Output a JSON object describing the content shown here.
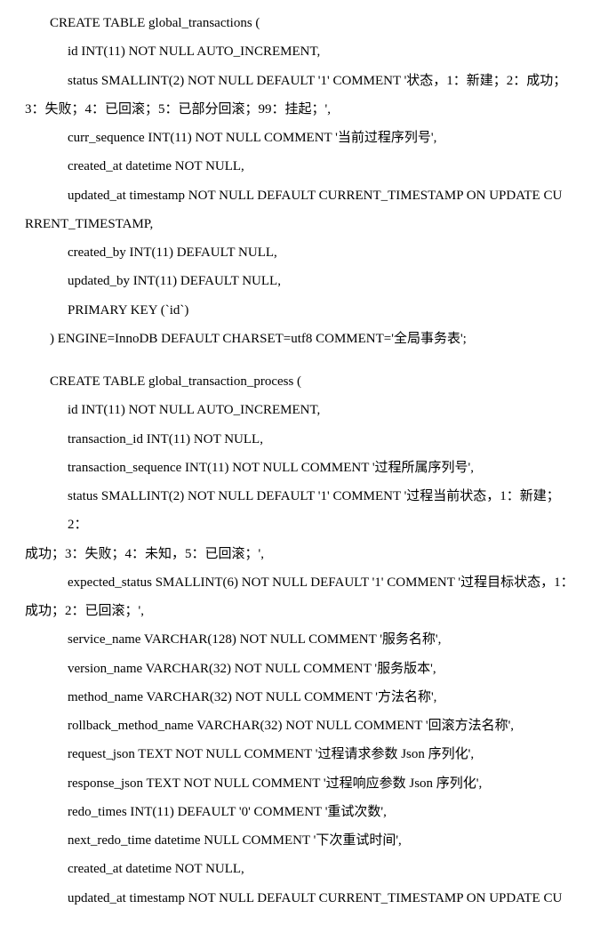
{
  "sql": {
    "table1": {
      "l1": "CREATE TABLE global_transactions (",
      "l2": "id INT(11) NOT NULL AUTO_INCREMENT,",
      "l3a": "status SMALLINT(2) NOT NULL DEFAULT '1' COMMENT '状态，1：新建；2：成功；",
      "l3b": "3：失败；4：已回滚；5：已部分回滚；99：挂起；',",
      "l4": "curr_sequence INT(11) NOT NULL COMMENT '当前过程序列号',",
      "l5": "created_at datetime NOT NULL,",
      "l6a": "updated_at timestamp NOT NULL DEFAULT CURRENT_TIMESTAMP ON UPDATE CU",
      "l6b": "RRENT_TIMESTAMP,",
      "l7": "created_by INT(11) DEFAULT NULL,",
      "l8": "updated_by INT(11) DEFAULT NULL,",
      "l9": "PRIMARY KEY (`id`)",
      "l10": ") ENGINE=InnoDB DEFAULT CHARSET=utf8 COMMENT='全局事务表';"
    },
    "table2": {
      "l1": "CREATE TABLE global_transaction_process (",
      "l2": "id INT(11) NOT NULL AUTO_INCREMENT,",
      "l3": "transaction_id INT(11) NOT NULL,",
      "l4": "transaction_sequence INT(11) NOT NULL COMMENT '过程所属序列号',",
      "l5a": "status SMALLINT(2) NOT NULL DEFAULT '1' COMMENT '过程当前状态，1：新建；2：",
      "l5b": "成功；3：失败；4：未知，5：已回滚；',",
      "l6a": "expected_status SMALLINT(6) NOT NULL DEFAULT '1' COMMENT '过程目标状态，1：",
      "l6b": "成功；2：已回滚；',",
      "l7": "service_name VARCHAR(128) NOT NULL COMMENT '服务名称',",
      "l8": "version_name VARCHAR(32) NOT NULL COMMENT '服务版本',",
      "l9": "method_name VARCHAR(32) NOT NULL COMMENT '方法名称',",
      "l10": "rollback_method_name VARCHAR(32) NOT NULL COMMENT '回滚方法名称',",
      "l11": "request_json TEXT NOT NULL COMMENT '过程请求参数 Json 序列化',",
      "l12": "response_json TEXT NOT NULL COMMENT '过程响应参数 Json 序列化',",
      "l13": "redo_times INT(11) DEFAULT '0' COMMENT '重试次数',",
      "l14": "next_redo_time datetime NULL COMMENT '下次重试时间',",
      "l15": "created_at datetime NOT NULL,",
      "l16": "updated_at timestamp NOT NULL DEFAULT CURRENT_TIMESTAMP ON UPDATE CU"
    }
  }
}
